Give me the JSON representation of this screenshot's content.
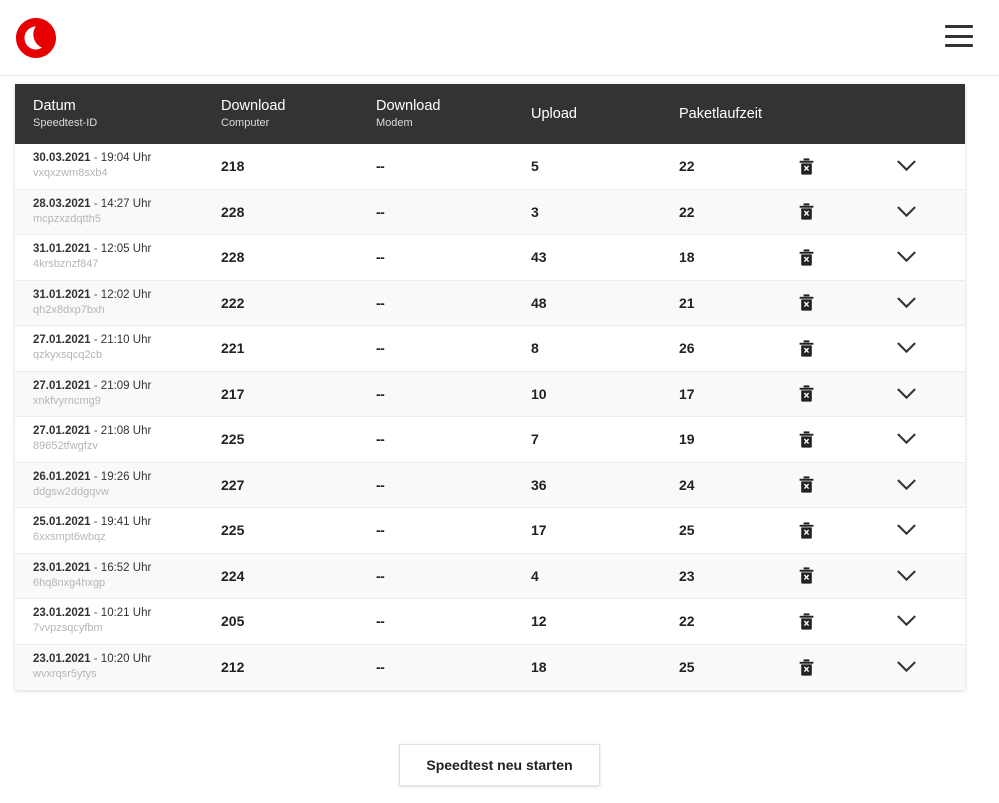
{
  "header": {
    "logo_name": "vodafone-logo",
    "logo_color": "#e60000",
    "menu_label": "Menü"
  },
  "table": {
    "columns": [
      {
        "main": "Datum",
        "sub": "Speedtest-ID"
      },
      {
        "main": "Download",
        "sub": "Computer"
      },
      {
        "main": "Download",
        "sub": "Modem"
      },
      {
        "main": "Upload",
        "sub": ""
      },
      {
        "main": "Paketlaufzeit",
        "sub": ""
      }
    ],
    "header_bg": "#333333",
    "row_actions": {
      "delete_label": "Löschen",
      "expand_label": "Details anzeigen"
    },
    "rows": [
      {
        "date": "30.03.2021",
        "sep": " - ",
        "time": "19:04 Uhr",
        "id": "vxqxzwm8sxb4",
        "download_computer": "218",
        "download_modem": "--",
        "upload": "5",
        "ping": "22"
      },
      {
        "date": "28.03.2021",
        "sep": " - ",
        "time": "14:27 Uhr",
        "id": "mcpzxzdqtth5",
        "download_computer": "228",
        "download_modem": "--",
        "upload": "3",
        "ping": "22"
      },
      {
        "date": "31.01.2021",
        "sep": " - ",
        "time": "12:05 Uhr",
        "id": "4krsbznzf847",
        "download_computer": "228",
        "download_modem": "--",
        "upload": "43",
        "ping": "18"
      },
      {
        "date": "31.01.2021",
        "sep": " - ",
        "time": "12:02 Uhr",
        "id": "qh2x8dxp7bxh",
        "download_computer": "222",
        "download_modem": "--",
        "upload": "48",
        "ping": "21"
      },
      {
        "date": "27.01.2021",
        "sep": " - ",
        "time": "21:10 Uhr",
        "id": "qzkyxsqcq2cb",
        "download_computer": "221",
        "download_modem": "--",
        "upload": "8",
        "ping": "26"
      },
      {
        "date": "27.01.2021",
        "sep": " - ",
        "time": "21:09 Uhr",
        "id": "xnkfvyrncmg9",
        "download_computer": "217",
        "download_modem": "--",
        "upload": "10",
        "ping": "17"
      },
      {
        "date": "27.01.2021",
        "sep": " - ",
        "time": "21:08 Uhr",
        "id": "89652tfwgfzv",
        "download_computer": "225",
        "download_modem": "--",
        "upload": "7",
        "ping": "19"
      },
      {
        "date": "26.01.2021",
        "sep": " - ",
        "time": "19:26 Uhr",
        "id": "ddgsw2ddgqvw",
        "download_computer": "227",
        "download_modem": "--",
        "upload": "36",
        "ping": "24"
      },
      {
        "date": "25.01.2021",
        "sep": " - ",
        "time": "19:41 Uhr",
        "id": "6xxsmpt6wbqz",
        "download_computer": "225",
        "download_modem": "--",
        "upload": "17",
        "ping": "25"
      },
      {
        "date": "23.01.2021",
        "sep": " - ",
        "time": "16:52 Uhr",
        "id": "6hq8nxg4hxgp",
        "download_computer": "224",
        "download_modem": "--",
        "upload": "4",
        "ping": "23"
      },
      {
        "date": "23.01.2021",
        "sep": " - ",
        "time": "10:21 Uhr",
        "id": "7vvpzsqcyfbm",
        "download_computer": "205",
        "download_modem": "--",
        "upload": "12",
        "ping": "22"
      },
      {
        "date": "23.01.2021",
        "sep": " - ",
        "time": "10:20 Uhr",
        "id": "wvxrqsr5ytys",
        "download_computer": "212",
        "download_modem": "--",
        "upload": "18",
        "ping": "25"
      }
    ]
  },
  "footer": {
    "restart_button": "Speedtest neu starten"
  }
}
